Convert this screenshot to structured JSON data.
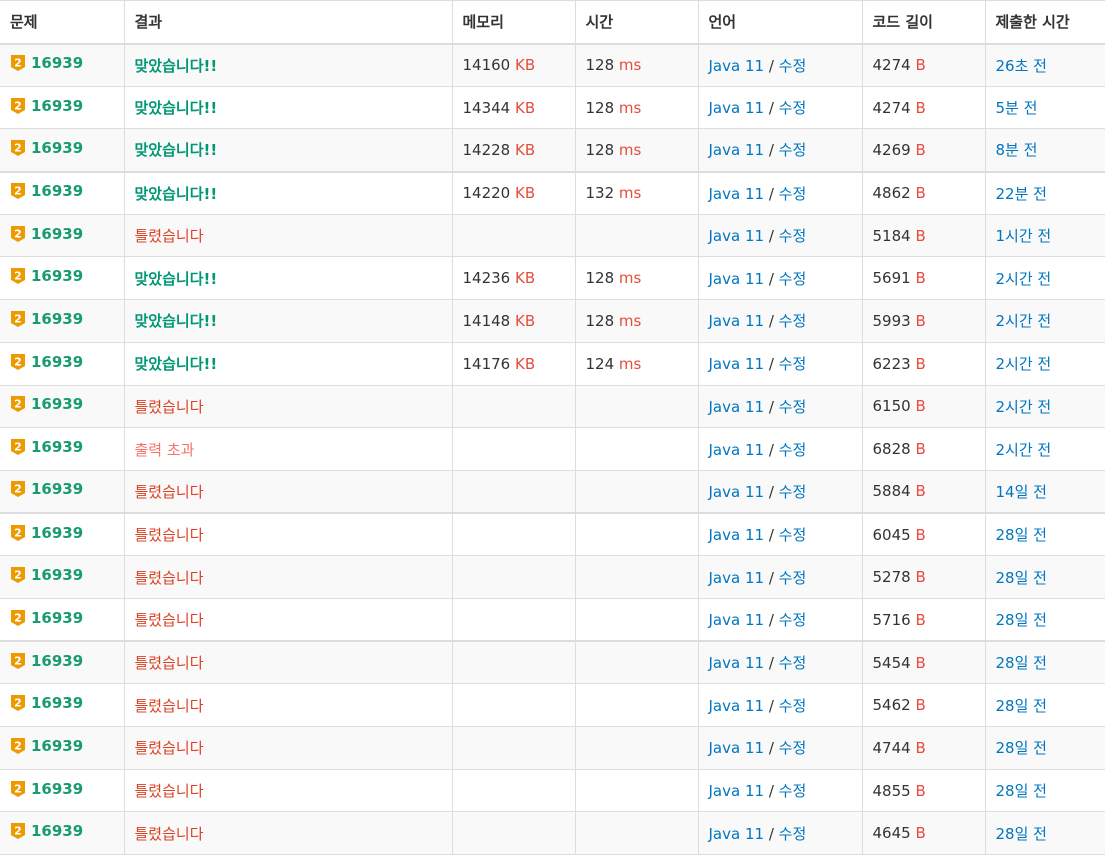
{
  "headers": [
    "문제",
    "결과",
    "메모리",
    "시간",
    "언어",
    "코드 길이",
    "제출한 시간"
  ],
  "units": {
    "memory": "KB",
    "time": "ms",
    "length": "B"
  },
  "edit_label": "수정",
  "language_sep": "/",
  "tier_badge": "2",
  "colors": {
    "accepted": "#009874",
    "wrong": "#dd4124",
    "output_exceeded": "#fa7268",
    "link": "#0076c0",
    "unit": "#e74c3c",
    "tier": "#ec9a00"
  },
  "rows": [
    {
      "problem": "16939",
      "result": "맞았습니다!!",
      "status": "ac",
      "memory": "14160",
      "time": "128",
      "language": "Java 11",
      "length": "4274",
      "submitted": "26초 전"
    },
    {
      "problem": "16939",
      "result": "맞았습니다!!",
      "status": "ac",
      "memory": "14344",
      "time": "128",
      "language": "Java 11",
      "length": "4274",
      "submitted": "5분 전"
    },
    {
      "problem": "16939",
      "result": "맞았습니다!!",
      "status": "ac",
      "memory": "14228",
      "time": "128",
      "language": "Java 11",
      "length": "4269",
      "submitted": "8분 전"
    },
    {
      "problem": "16939",
      "result": "맞았습니다!!",
      "status": "ac",
      "memory": "14220",
      "time": "132",
      "language": "Java 11",
      "length": "4862",
      "submitted": "22분 전"
    },
    {
      "problem": "16939",
      "result": "틀렸습니다",
      "status": "wa",
      "memory": "",
      "time": "",
      "language": "Java 11",
      "length": "5184",
      "submitted": "1시간 전"
    },
    {
      "problem": "16939",
      "result": "맞았습니다!!",
      "status": "ac",
      "memory": "14236",
      "time": "128",
      "language": "Java 11",
      "length": "5691",
      "submitted": "2시간 전"
    },
    {
      "problem": "16939",
      "result": "맞았습니다!!",
      "status": "ac",
      "memory": "14148",
      "time": "128",
      "language": "Java 11",
      "length": "5993",
      "submitted": "2시간 전"
    },
    {
      "problem": "16939",
      "result": "맞았습니다!!",
      "status": "ac",
      "memory": "14176",
      "time": "124",
      "language": "Java 11",
      "length": "6223",
      "submitted": "2시간 전"
    },
    {
      "problem": "16939",
      "result": "틀렸습니다",
      "status": "wa",
      "memory": "",
      "time": "",
      "language": "Java 11",
      "length": "6150",
      "submitted": "2시간 전"
    },
    {
      "problem": "16939",
      "result": "출력 초과",
      "status": "ole",
      "memory": "",
      "time": "",
      "language": "Java 11",
      "length": "6828",
      "submitted": "2시간 전"
    },
    {
      "problem": "16939",
      "result": "틀렸습니다",
      "status": "wa",
      "memory": "",
      "time": "",
      "language": "Java 11",
      "length": "5884",
      "submitted": "14일 전"
    },
    {
      "problem": "16939",
      "result": "틀렸습니다",
      "status": "wa",
      "memory": "",
      "time": "",
      "language": "Java 11",
      "length": "6045",
      "submitted": "28일 전"
    },
    {
      "problem": "16939",
      "result": "틀렸습니다",
      "status": "wa",
      "memory": "",
      "time": "",
      "language": "Java 11",
      "length": "5278",
      "submitted": "28일 전"
    },
    {
      "problem": "16939",
      "result": "틀렸습니다",
      "status": "wa",
      "memory": "",
      "time": "",
      "language": "Java 11",
      "length": "5716",
      "submitted": "28일 전"
    },
    {
      "problem": "16939",
      "result": "틀렸습니다",
      "status": "wa",
      "memory": "",
      "time": "",
      "language": "Java 11",
      "length": "5454",
      "submitted": "28일 전"
    },
    {
      "problem": "16939",
      "result": "틀렸습니다",
      "status": "wa",
      "memory": "",
      "time": "",
      "language": "Java 11",
      "length": "5462",
      "submitted": "28일 전"
    },
    {
      "problem": "16939",
      "result": "틀렸습니다",
      "status": "wa",
      "memory": "",
      "time": "",
      "language": "Java 11",
      "length": "4744",
      "submitted": "28일 전"
    },
    {
      "problem": "16939",
      "result": "틀렸습니다",
      "status": "wa",
      "memory": "",
      "time": "",
      "language": "Java 11",
      "length": "4855",
      "submitted": "28일 전"
    },
    {
      "problem": "16939",
      "result": "틀렸습니다",
      "status": "wa",
      "memory": "",
      "time": "",
      "language": "Java 11",
      "length": "4645",
      "submitted": "28일 전"
    }
  ]
}
